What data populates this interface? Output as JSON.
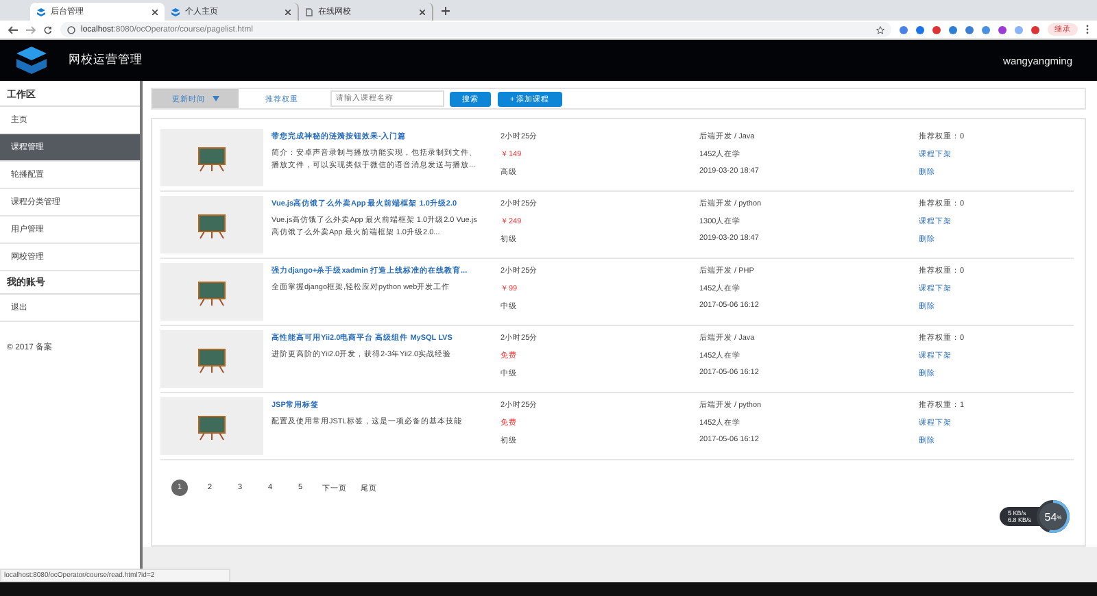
{
  "browser": {
    "tabs": [
      {
        "label": "后台管理",
        "selected": true,
        "kind": "site"
      },
      {
        "label": "个人主页",
        "selected": false,
        "kind": "site"
      },
      {
        "label": "在线网校",
        "selected": false,
        "kind": "page"
      }
    ],
    "address": {
      "host": "localhost",
      "rest": ":8080/ocOperator/course/pagelist.html"
    },
    "profile": "继承",
    "status_url": "localhost:8080/ocOperator/course/read.html?id=2"
  },
  "header": {
    "title": "网校运营管理",
    "user": "wangyangming"
  },
  "sidebar": {
    "sections": [
      {
        "title": "工作区",
        "items": [
          {
            "label": "主页",
            "selected": false
          },
          {
            "label": "课程管理",
            "selected": true
          },
          {
            "label": "轮播配置",
            "selected": false
          },
          {
            "label": "课程分类管理",
            "selected": false
          },
          {
            "label": "用户管理",
            "selected": false
          },
          {
            "label": "网校管理",
            "selected": false
          }
        ]
      },
      {
        "title": "我的账号",
        "items": [
          {
            "label": "退出",
            "selected": false
          }
        ]
      }
    ],
    "footer": "© 2017 备案"
  },
  "toolbar": {
    "sorts": [
      {
        "label": "更新时间",
        "selected": true
      },
      {
        "label": "推荐权重",
        "selected": false
      }
    ],
    "search": {
      "placeholder": "请输入课程名称"
    },
    "search_button": "搜索",
    "add_button": "+ 添加课程"
  },
  "courses": [
    {
      "title": "带您完成神秘的涟漪按钮效果-入门篇",
      "desc": "简介：安卓声音录制与播放功能实现，包括录制到文件、播放文件，可以实现类似于微信的语音消息发送与播放...",
      "duration": "2小时25分",
      "price": "￥149",
      "level": "高级",
      "category": "后端开发 / Java",
      "students": "1452人在学",
      "date": "2019-03-20 18:47",
      "weight": "推荐权重：0",
      "offline": "课程下架",
      "delete": "删除"
    },
    {
      "title": "Vue.js高仿饿了么外卖App 最火前端框架 1.0升级2.0",
      "desc": "Vue.js高仿饿了么外卖App 最火前端框架 1.0升级2.0 Vue.js高仿饿了么外卖App 最火前端框架 1.0升级2.0...",
      "duration": "2小时25分",
      "price": "￥249",
      "level": "初级",
      "category": "后端开发 / python",
      "students": "1300人在学",
      "date": "2019-03-20 18:47",
      "weight": "推荐权重：0",
      "offline": "课程下架",
      "delete": "删除"
    },
    {
      "title": "强力django+杀手级xadmin 打造上线标准的在线教育...",
      "desc": "全面掌握django框架,轻松应对python web开发工作",
      "duration": "2小时25分",
      "price": "￥99",
      "level": "中级",
      "category": "后端开发 / PHP",
      "students": "1452人在学",
      "date": "2017-05-06 16:12",
      "weight": "推荐权重：0",
      "offline": "课程下架",
      "delete": "删除"
    },
    {
      "title": "高性能高可用Yii2.0电商平台 高级组件 MySQL LVS",
      "desc": "进阶更高阶的Yii2.0开发，获得2-3年Yii2.0实战经验",
      "duration": "2小时25分",
      "price": "免费",
      "level": "中级",
      "category": "后端开发 / Java",
      "students": "1452人在学",
      "date": "2017-05-06 16:12",
      "weight": "推荐权重：0",
      "offline": "课程下架",
      "delete": "删除"
    },
    {
      "title": "JSP常用标签",
      "desc": "配置及使用常用JSTL标签，这是一项必备的基本技能",
      "duration": "2小时25分",
      "price": "免费",
      "level": "初级",
      "category": "后端开发 / python",
      "students": "1452人在学",
      "date": "2017-05-06 16:12",
      "weight": "推荐权重：1",
      "offline": "课程下架",
      "delete": "删除"
    }
  ],
  "pagination": [
    {
      "label": "1",
      "selected": true
    },
    {
      "label": "2",
      "selected": false
    },
    {
      "label": "3",
      "selected": false
    },
    {
      "label": "4",
      "selected": false
    },
    {
      "label": "5",
      "selected": false
    },
    {
      "label": "下一页",
      "selected": false
    },
    {
      "label": "尾页",
      "selected": false
    }
  ],
  "speed_widget": {
    "up": "5",
    "up_unit": "KB/s",
    "down": "6.8",
    "down_unit": "KB/s",
    "percent": "54",
    "percent_unit": "%",
    "level": 0.54
  }
}
